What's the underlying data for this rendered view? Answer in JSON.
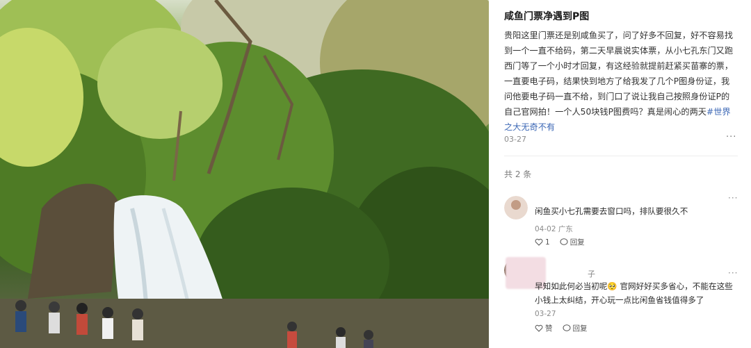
{
  "photo": {
    "alt_icon": "waterfall-photo"
  },
  "post": {
    "title": "咸鱼门票净遇到P图",
    "body_main": "贵阳这里门票还是别咸鱼买了，问了好多不回复，好不容易找到一个一直不给码，第二天早晨说实体票，从小七孔东门又跑西门等了一个小时才回复，有这经验就提前赶紧买苗寨的票，一直要电子码，结果快到地方了给我发了几个P图身份证，我问他要电子码一直不给，到门口了说让我自己按照身份证P的自己官网拍！一个人50块钱P图费吗？真是闹心的两天",
    "hashtag": "#世界之大无奇不有",
    "date": "03-27",
    "more": "···",
    "comment_count": "共 2 条"
  },
  "comments": [
    {
      "name": "",
      "text": "闲鱼买小七孔需要去窗口吗，排队要很久不",
      "date_loc": "04-02 广东",
      "like": "1",
      "reply": "回复",
      "more": "···"
    },
    {
      "name": "子",
      "text": "早知如此何必当初呢🥺 官网好好买多省心，不能在这些小钱上太纠结，开心玩一点比闲鱼省钱值得多了",
      "date_loc": "03-27",
      "like": "赞",
      "reply": "回复",
      "more": "···"
    }
  ],
  "colors": {
    "hashtag": "#3b67b5",
    "text": "#333333",
    "muted": "#8a8a8a"
  }
}
